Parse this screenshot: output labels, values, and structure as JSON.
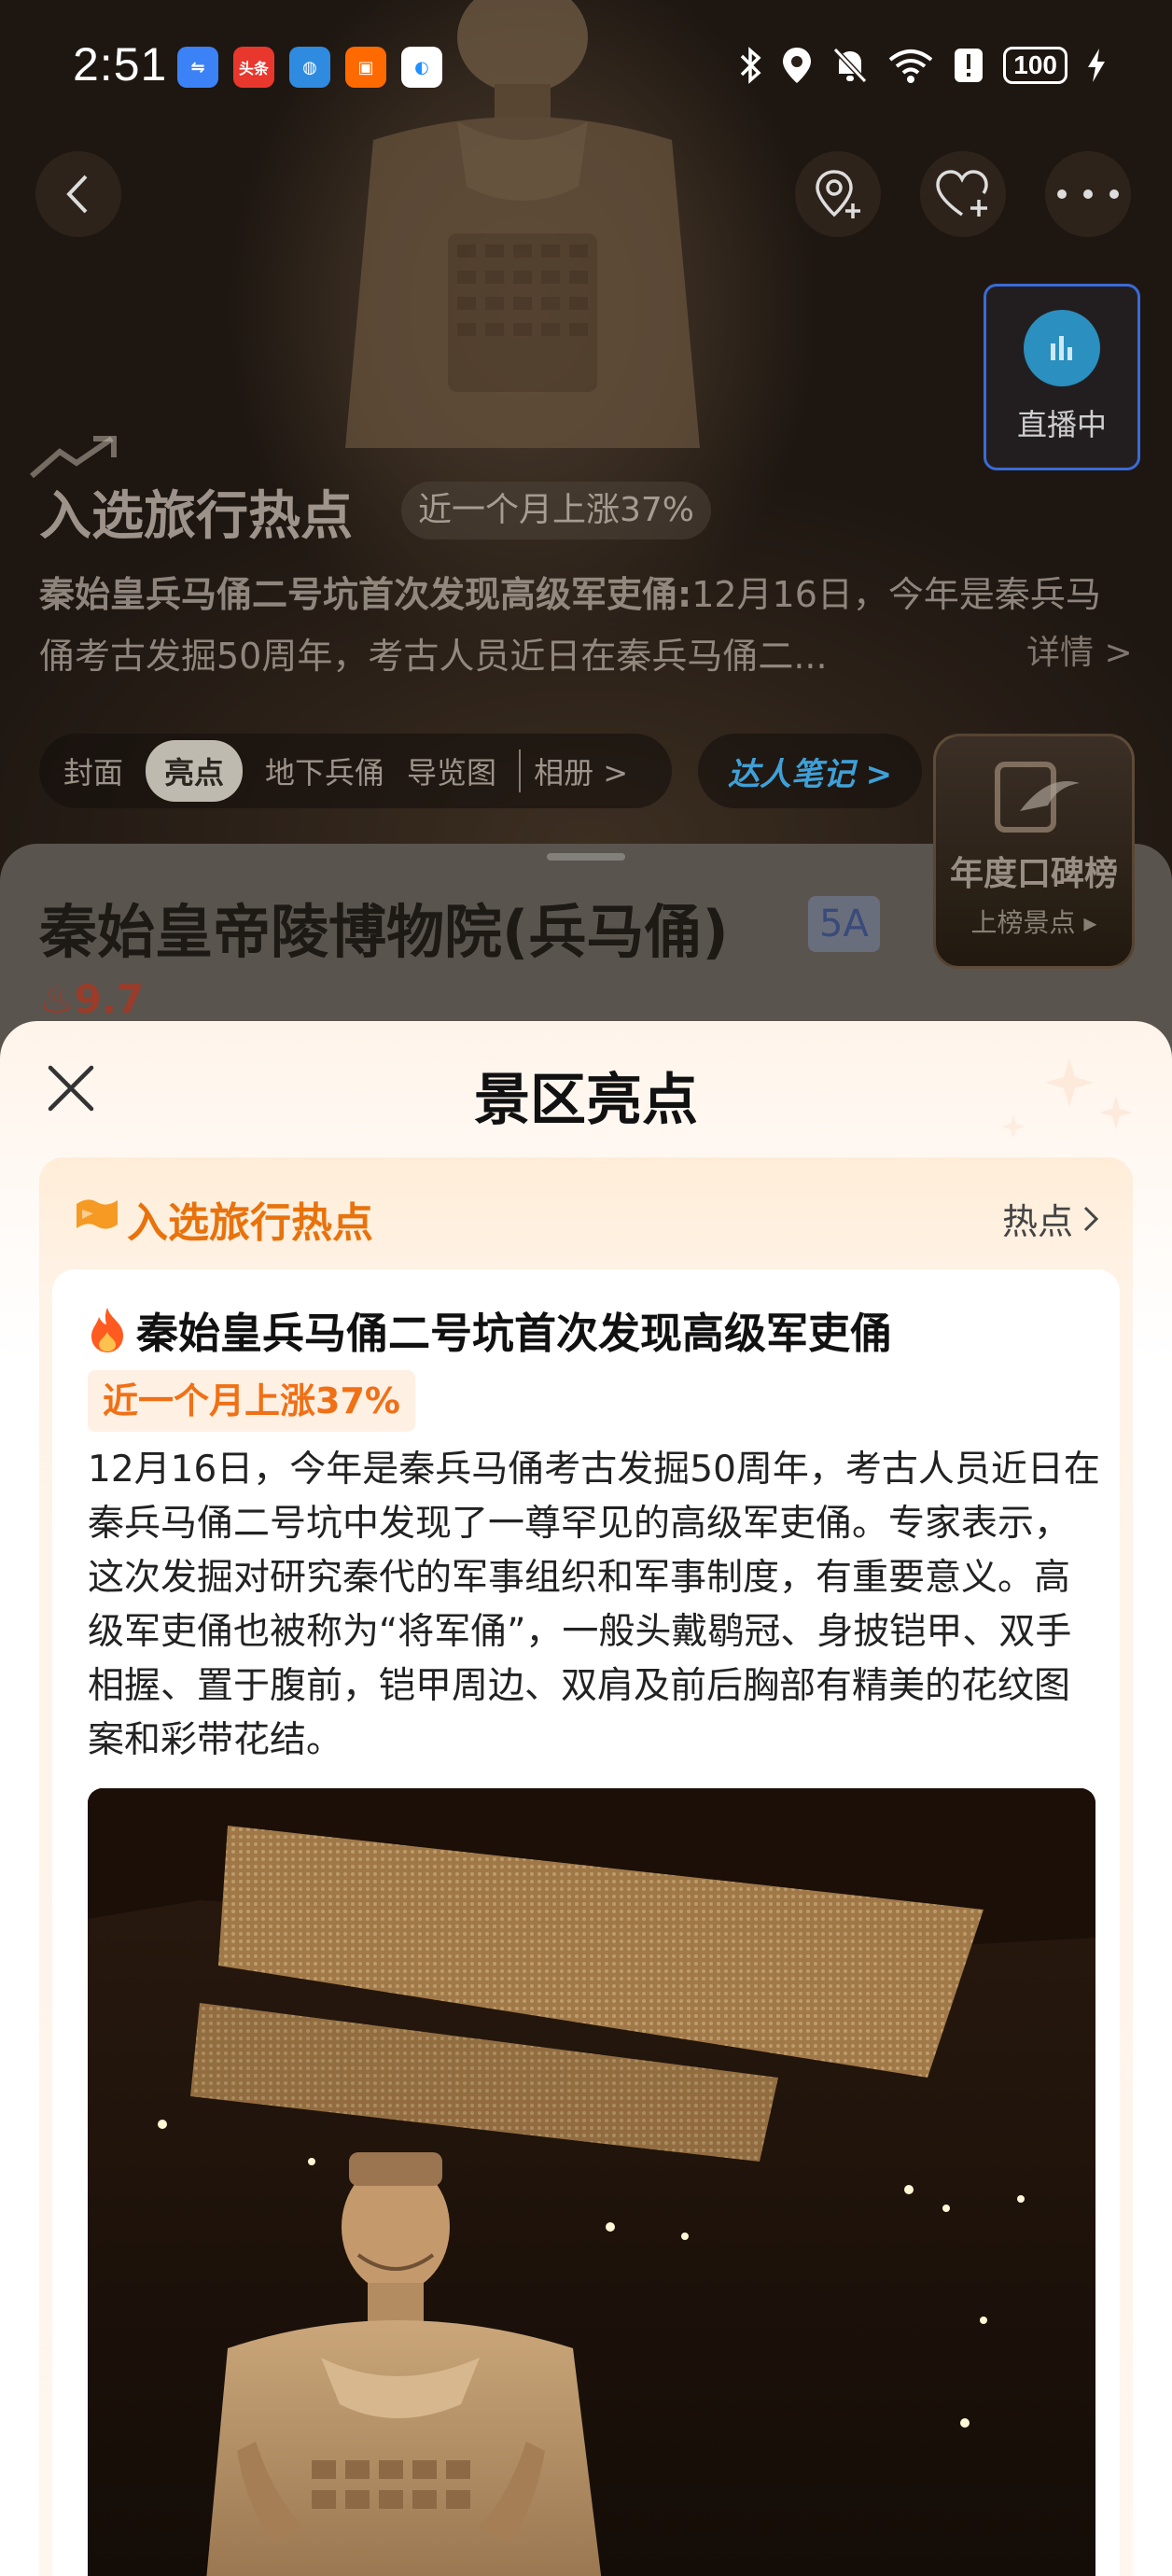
{
  "status_bar": {
    "time": "2:51",
    "battery": "100",
    "app_icons": [
      {
        "name": "usb-icon",
        "label": "",
        "color": "#3b82f6"
      },
      {
        "name": "toutiao-icon",
        "label": "头条",
        "color": "#e8372c"
      },
      {
        "name": "browser-icon",
        "label": "",
        "color": "#2f8be0"
      },
      {
        "name": "app-icon",
        "label": "",
        "color": "#ff6a00"
      },
      {
        "name": "compass-icon",
        "label": "",
        "color": "#1e90ff"
      }
    ]
  },
  "hero": {
    "live_label": "直播中",
    "hot_title": "入选旅行热点",
    "hot_rise": "近一个月上涨37%",
    "hot_headline": "秦始皇兵马俑二号坑首次发现高级军吏俑:",
    "hot_excerpt": "12月16日，今年是秦兵马俑考古发掘50周年，考古人员近日在秦兵马俑二...",
    "detail_link": "详情 >",
    "tabs": [
      "封面",
      "亮点",
      "地下兵俑",
      "导览图",
      "相册 >"
    ],
    "expert_note": "达人笔记 >",
    "ranking_title": "年度口碑榜",
    "ranking_sub": "上榜景点 ▸"
  },
  "scenic": {
    "name": "秦始皇帝陵博物院(兵马俑)",
    "grade": "5A",
    "score": "9.7"
  },
  "sheet": {
    "title": "景区亮点",
    "section_title": "入选旅行热点",
    "section_link": "热点",
    "card_title": "秦始皇兵马俑二号坑首次发现高级军吏俑",
    "rise_badge": "近一个月上涨37%",
    "card_body": "12月16日，今年是秦兵马俑考古发掘50周年，考古人员近日在秦兵马俑二号坑中发现了一尊罕见的高级军吏俑。专家表示，这次发掘对研究秦代的军事组织和军事制度，有重要意义。高级军吏俑也被称为“将军俑”，一般头戴鹖冠、身披铠甲、双手相握、置于腹前，铠甲周边、双肩及前后胸部有精美的花纹图案和彩带花结。"
  }
}
